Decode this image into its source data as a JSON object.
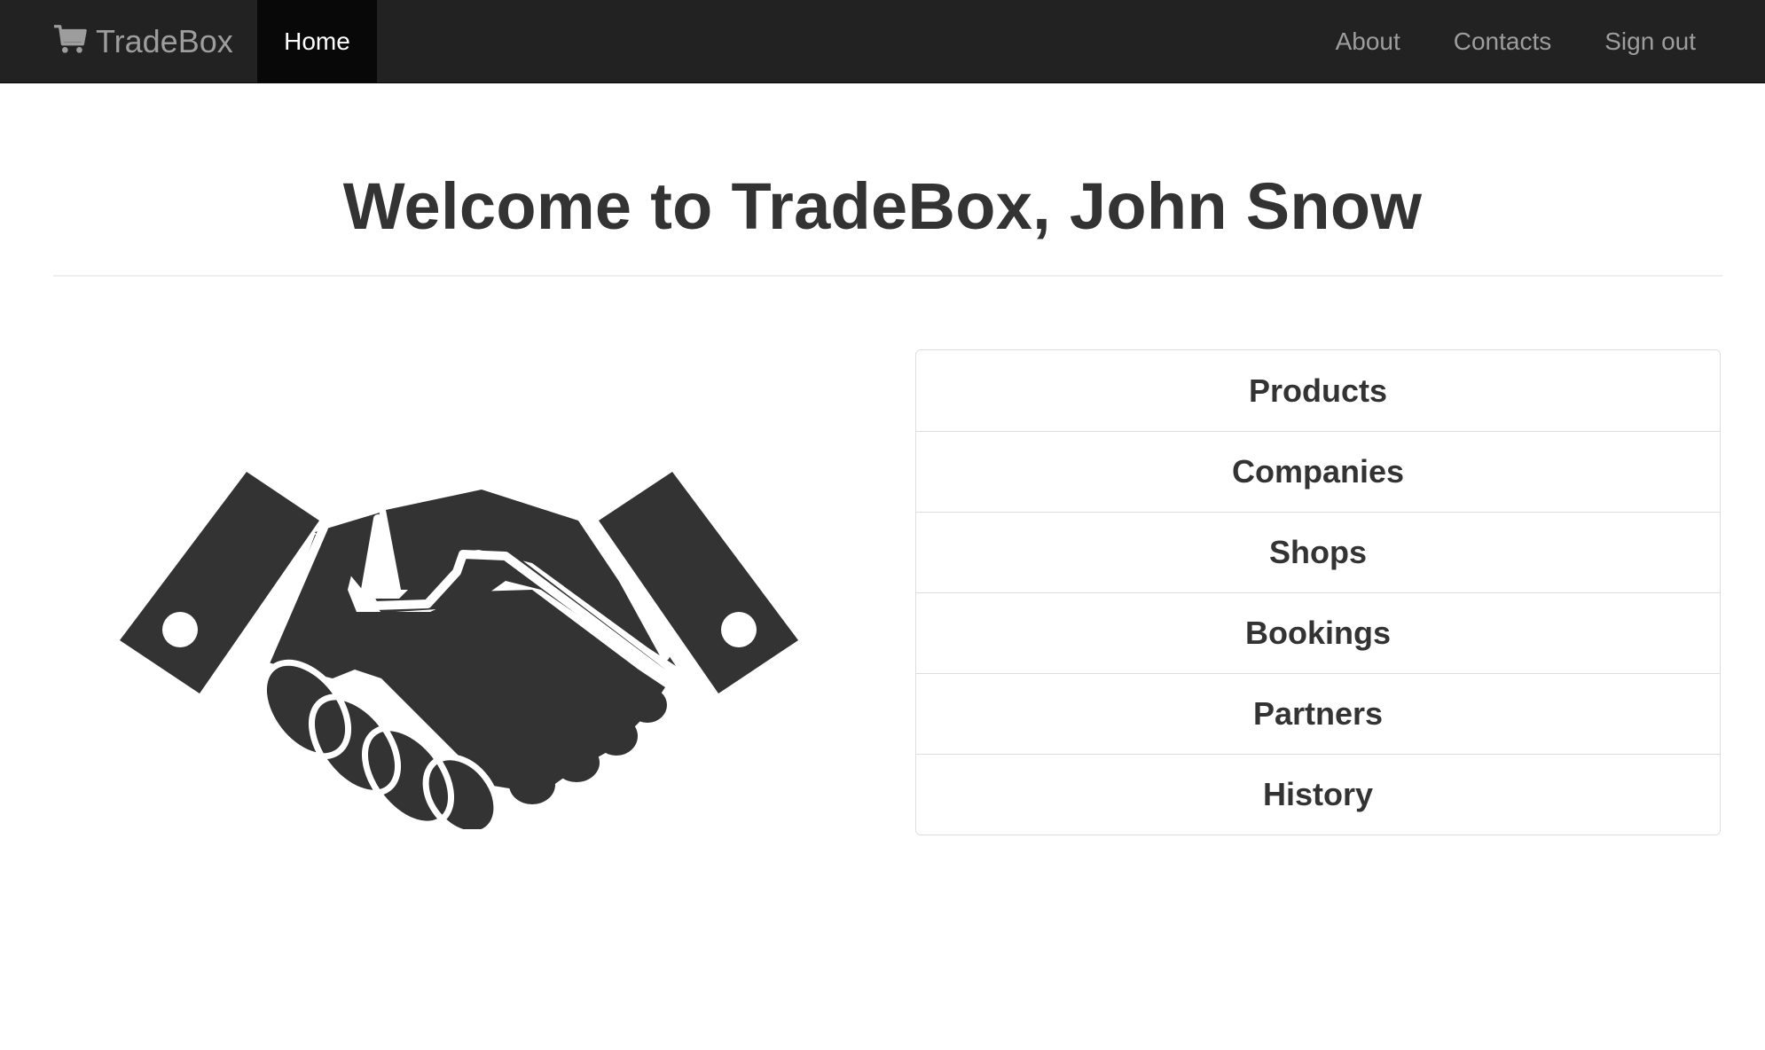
{
  "navbar": {
    "brand_icon": "shopping-cart-icon",
    "brand": "TradeBox",
    "home": "Home",
    "about": "About",
    "contacts": "Contacts",
    "sign_out": "Sign out"
  },
  "main": {
    "headline": "Welcome to TradeBox, John Snow",
    "hero_icon": "handshake-icon",
    "menu": [
      {
        "label": "Products"
      },
      {
        "label": "Companies"
      },
      {
        "label": "Shops"
      },
      {
        "label": "Bookings"
      },
      {
        "label": "Partners"
      },
      {
        "label": "History"
      }
    ]
  },
  "colors": {
    "navbar_bg": "#222222",
    "navbar_active_bg": "#080808",
    "navbar_text": "#9d9d9d",
    "text": "#333333"
  }
}
